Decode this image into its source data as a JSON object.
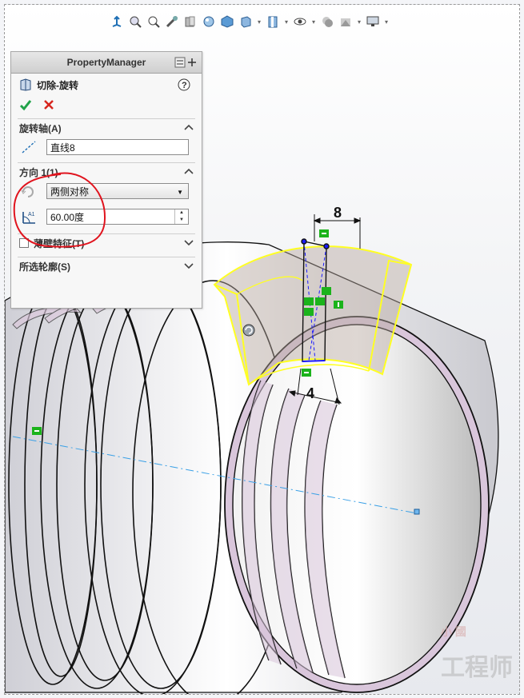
{
  "toolbar": {
    "icons": [
      "view-orientation-icon",
      "zoom-to-fit-icon",
      "zoom-area-icon",
      "previous-view-icon",
      "section-view-icon",
      "dynamic-annotation-icon",
      "display-style-icon",
      "hide-show-icon",
      "edit-appearance-icon",
      "apply-scene-icon",
      "view-settings-icon"
    ]
  },
  "pm": {
    "header": "PropertyManager",
    "feature_title": "切除-旋转",
    "axis_group": {
      "title": "旋转轴(A)",
      "value": "直线8"
    },
    "direction_group": {
      "title": "方向 1(1)",
      "type_value": "两侧对称",
      "angle_value": "60.00度",
      "angle_icon_label": "A1"
    },
    "thin_feature": {
      "title": "薄壁特征(T)",
      "checked": false
    },
    "selected_contours": {
      "title": "所选轮廓(S)"
    }
  },
  "dimensions": {
    "top": "8",
    "bottom": "4"
  },
  "colors": {
    "accent_pink": "#d9c6db",
    "sketch_blue": "#1a1aff",
    "highlight_yellow": "#ffff33",
    "annotation_red": "#e0141e",
    "relation_green": "#1bb31b"
  },
  "watermark": {
    "line1": "小 國",
    "line2": "工程师"
  }
}
